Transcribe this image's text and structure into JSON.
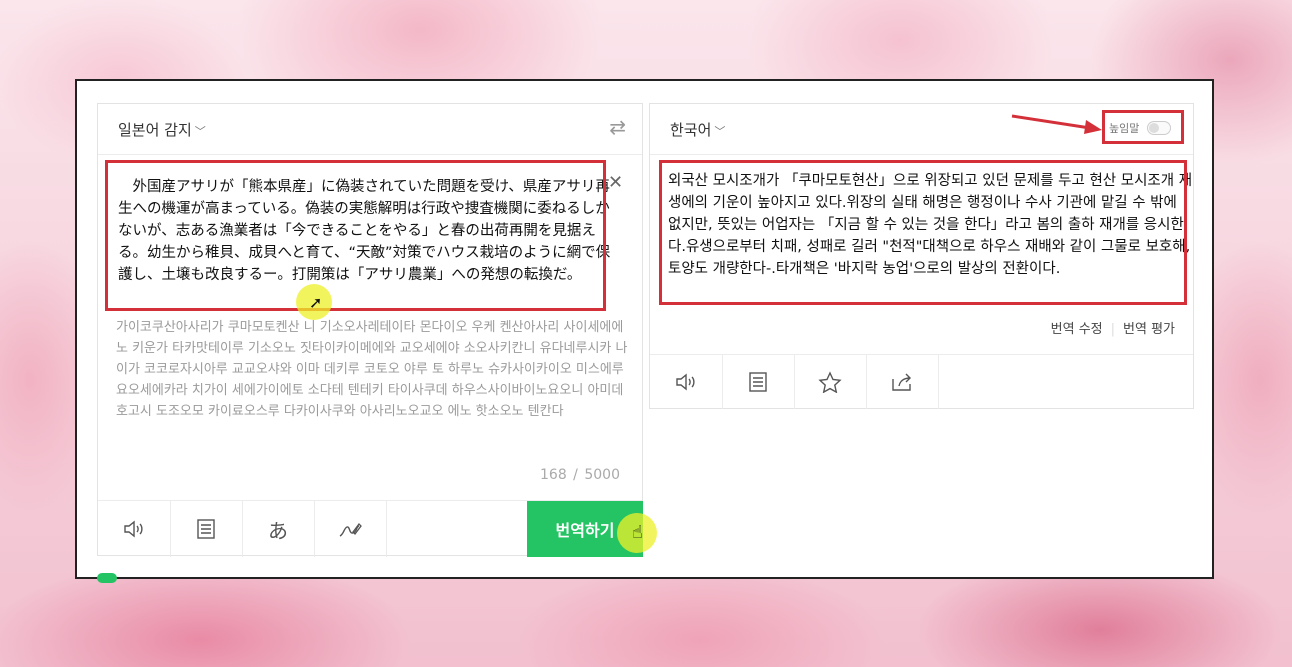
{
  "source": {
    "language_label": "일본어 감지",
    "swap_icon": "swap-arrows-icon",
    "text": "　外国産アサリが「熊本県産」に偽装されていた問題を受け、県産アサリ再生への機運が高まっている。偽装の実態解明は行政や捜査機関に委ねるしかないが、志ある漁業者は「今できることをやる」と春の出荷再開を見据える。幼生から稚貝、成貝へと育て、“天敵”対策でハウス栽培のように網で保護し、土壌も改良するー。打開策は「アサリ農業」への発想の転換だ。",
    "pronunciation": "가이코쿠산아사리가 쿠마모토켄산 니 기소오사레테이타 몬다이오 우케 켄산아사리 사이세에에노 키운가 타카맛테이루 기소오노 짓타이카이메에와 교오세에야 소오사키칸니 유다네루시카 나이가 코코로자시아루 교교오샤와 이마 데키루 코토오 야루 토 하루노 슈카사이카이오 미스에루 요오세에카라 치가이 세에가이에토 소다테 텐테키 타이사쿠데 하우스사이바이노요오니 아미데 호고시 도조오모 카이료오스루 다카이사쿠와 아사리노오교오 에노 핫소오노 텐칸다",
    "char_count": "168",
    "char_limit": "5000",
    "clear_icon": "close-icon",
    "toolbar": {
      "listen_icon": "speaker-icon",
      "dictionary_icon": "document-icon",
      "kana_label": "あ",
      "handwriting_icon": "handwriting-icon"
    },
    "translate_button": "번역하기"
  },
  "target": {
    "language_label": "한국어",
    "honorific_label": "높임말",
    "honorific_on": false,
    "text": "외국산 모시조개가 「쿠마모토현산」으로 위장되고 있던 문제를 두고 현산 모시조개 재생에의 기운이 높아지고 있다.위장의 실태 해명은 행정이나 수사 기관에 맡길 수 밖에 없지만, 뜻있는 어업자는 「지금 할 수 있는 것을 한다」라고 봄의 출하 재개를 응시한다.유생으로부터 치패, 성패로 길러 \"천적\"대책으로 하우스 재배와 같이 그물로 보호해, 토양도 개량한다-.타개책은 '바지락 농업'으로의 발상의 전환이다.",
    "edit_label": "번역 수정",
    "rate_label": "번역 평가",
    "toolbar": {
      "listen_icon": "speaker-icon",
      "copy_icon": "document-icon",
      "favorite_icon": "star-icon",
      "share_icon": "share-icon"
    }
  },
  "colors": {
    "accent_green": "#24c464",
    "highlight_red": "#d4303a"
  }
}
